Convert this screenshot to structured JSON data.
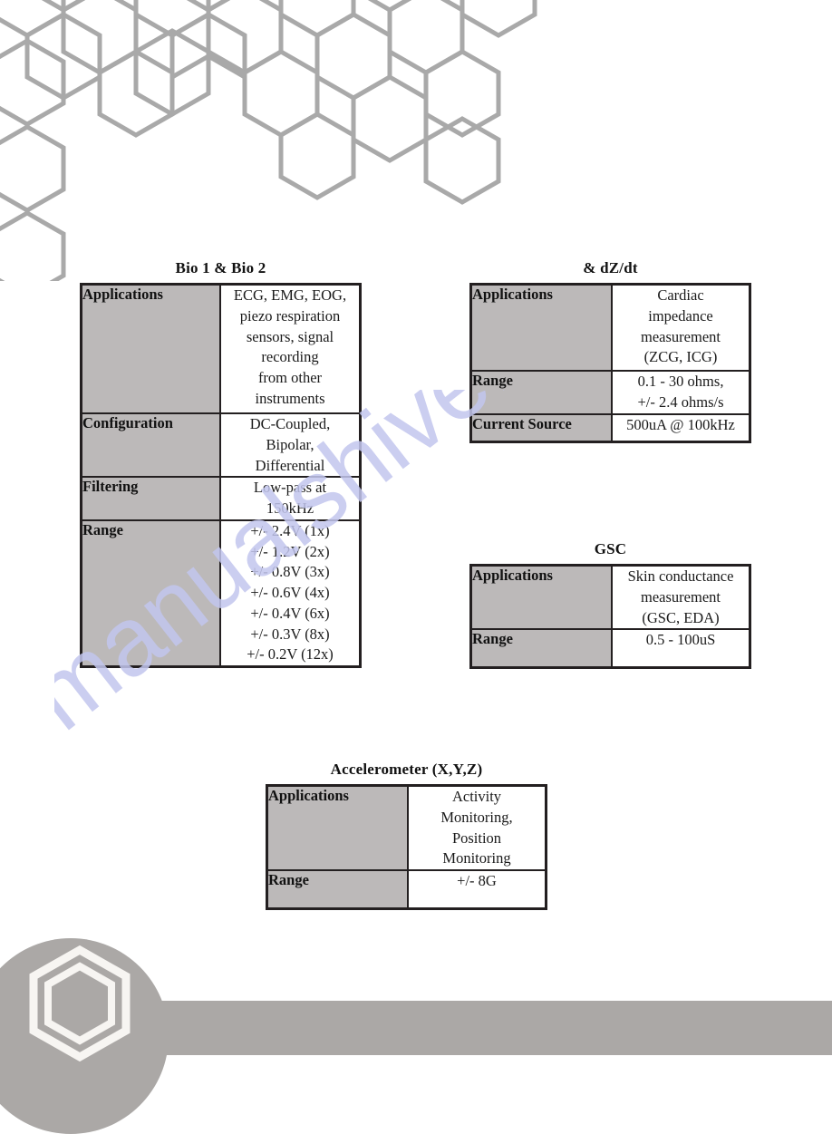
{
  "watermark": {
    "text": "manualshive.com"
  },
  "decoration": {
    "honeycomb_color": "#a9a9a9",
    "footer_color": "#aba8a6",
    "logo_name": "hexagon-logo"
  },
  "blocks": [
    {
      "id": "bio",
      "title": "Bio 1 & Bio 2",
      "rows": [
        {
          "label": "Applications",
          "value_lines": [
            "ECG, EMG, EOG,",
            "piezo respiration",
            "sensors, signal",
            "recording",
            "from other",
            "instruments"
          ]
        },
        {
          "label": "Configuration",
          "value_lines": [
            "DC-Coupled,",
            "Bipolar,",
            "Differential"
          ]
        },
        {
          "label": "Filtering",
          "value_lines": [
            "Low-pass at",
            "150kHz"
          ]
        },
        {
          "label": "Range",
          "value_lines": [
            "+/- 2.4V (1x)",
            "+/- 1.2V (2x)",
            "+/- 0.8V (3x)",
            "+/- 0.6V (4x)",
            "+/- 0.4V (6x)",
            "+/- 0.3V (8x)",
            "+/- 0.2V (12x)"
          ]
        }
      ]
    },
    {
      "id": "dzdt",
      "title": "& dZ/dt",
      "rows": [
        {
          "label": "Applications",
          "value_lines": [
            "Cardiac",
            "impedance",
            "measurement",
            "(ZCG, ICG)"
          ]
        },
        {
          "label": "Range",
          "value_lines": [
            "0.1 - 30 ohms,",
            "+/- 2.4 ohms/s"
          ]
        },
        {
          "label": "Current Source",
          "value_lines": [
            "500uA @ 100kHz"
          ]
        }
      ]
    },
    {
      "id": "gsc",
      "title": "GSC",
      "rows": [
        {
          "label": "Applications",
          "value_lines": [
            "Skin conductance",
            "measurement",
            "(GSC, EDA)"
          ]
        },
        {
          "label": "Range",
          "value_lines": [
            "0.5 - 100uS"
          ]
        }
      ]
    },
    {
      "id": "accel",
      "title": "Accelerometer (X,Y,Z)",
      "rows": [
        {
          "label": "Applications",
          "value_lines": [
            "Activity",
            "Monitoring,",
            "Position",
            "Monitoring"
          ]
        },
        {
          "label": "Range",
          "value_lines": [
            "+/- 8G"
          ]
        }
      ]
    }
  ]
}
